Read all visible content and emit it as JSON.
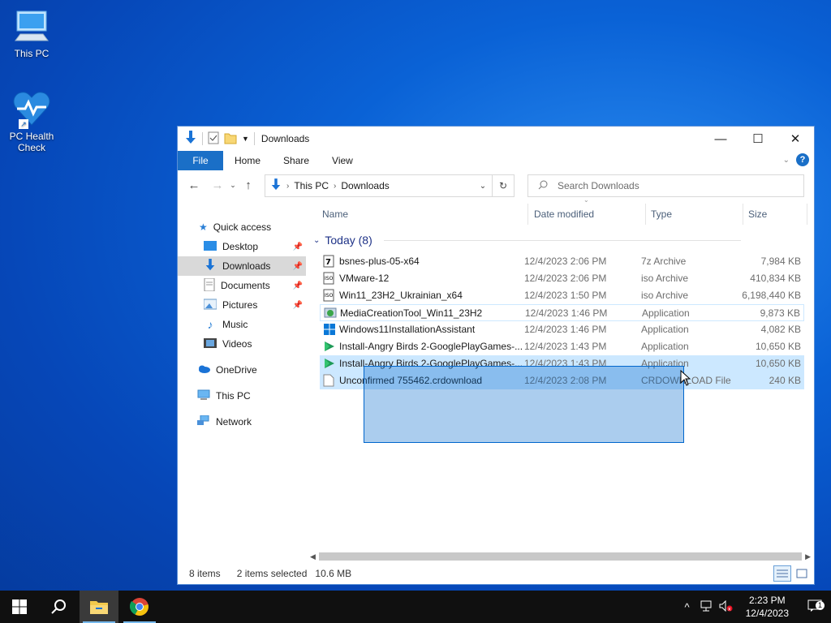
{
  "desktop": {
    "icons": [
      {
        "label": "This PC"
      },
      {
        "label": "PC Health Check"
      }
    ]
  },
  "window": {
    "title": "Downloads",
    "controls": {
      "minimize": "—",
      "maximize": "☐",
      "close": "✕"
    },
    "ribbon": {
      "tabs": [
        "File",
        "Home",
        "Share",
        "View"
      ],
      "help": "?"
    },
    "address": {
      "crumbs": [
        "This PC",
        "Downloads"
      ]
    },
    "search": {
      "placeholder": "Search Downloads"
    },
    "nav": {
      "quick_access": "Quick access",
      "items": [
        {
          "label": "Desktop",
          "pinned": true
        },
        {
          "label": "Downloads",
          "pinned": true,
          "selected": true
        },
        {
          "label": "Documents",
          "pinned": true
        },
        {
          "label": "Pictures",
          "pinned": true
        },
        {
          "label": "Music",
          "pinned": false
        },
        {
          "label": "Videos",
          "pinned": false
        }
      ],
      "onedrive": "OneDrive",
      "this_pc": "This PC",
      "network": "Network"
    },
    "columns": {
      "name": "Name",
      "date": "Date modified",
      "type": "Type",
      "size": "Size"
    },
    "group": "Today (8)",
    "files": [
      {
        "name": "bsnes-plus-05-x64",
        "date": "12/4/2023 2:06 PM",
        "type": "7z Archive",
        "size": "7,984 KB",
        "icon": "archive-icon"
      },
      {
        "name": "VMware-12",
        "date": "12/4/2023 2:06 PM",
        "type": "iso Archive",
        "size": "410,834 KB",
        "icon": "iso-icon"
      },
      {
        "name": "Win11_23H2_Ukrainian_x64",
        "date": "12/4/2023 1:50 PM",
        "type": "iso Archive",
        "size": "6,198,440 KB",
        "icon": "iso-icon"
      },
      {
        "name": "MediaCreationTool_Win11_23H2",
        "date": "12/4/2023 1:46 PM",
        "type": "Application",
        "size": "9,873 KB",
        "icon": "app-icon"
      },
      {
        "name": "Windows11InstallationAssistant",
        "date": "12/4/2023 1:46 PM",
        "type": "Application",
        "size": "4,082 KB",
        "icon": "windows-icon"
      },
      {
        "name": "Install-Angry Birds 2-GooglePlayGames-...",
        "date": "12/4/2023 1:43 PM",
        "type": "Application",
        "size": "10,650 KB",
        "icon": "play-games-icon"
      },
      {
        "name": "Install-Angry Birds 2-GooglePlayGames-...",
        "date": "12/4/2023 1:43 PM",
        "type": "Application",
        "size": "10,650 KB",
        "icon": "play-games-icon"
      },
      {
        "name": "Unconfirmed 755462.crdownload",
        "date": "12/4/2023 2:08 PM",
        "type": "CRDOWNLOAD File",
        "size": "240 KB",
        "icon": "file-icon"
      }
    ],
    "status": {
      "items": "8 items",
      "selected": "2 items selected",
      "size": "10.6 MB"
    }
  },
  "taskbar": {
    "clock_time": "2:23 PM",
    "clock_date": "12/4/2023",
    "notification_count": "1"
  }
}
